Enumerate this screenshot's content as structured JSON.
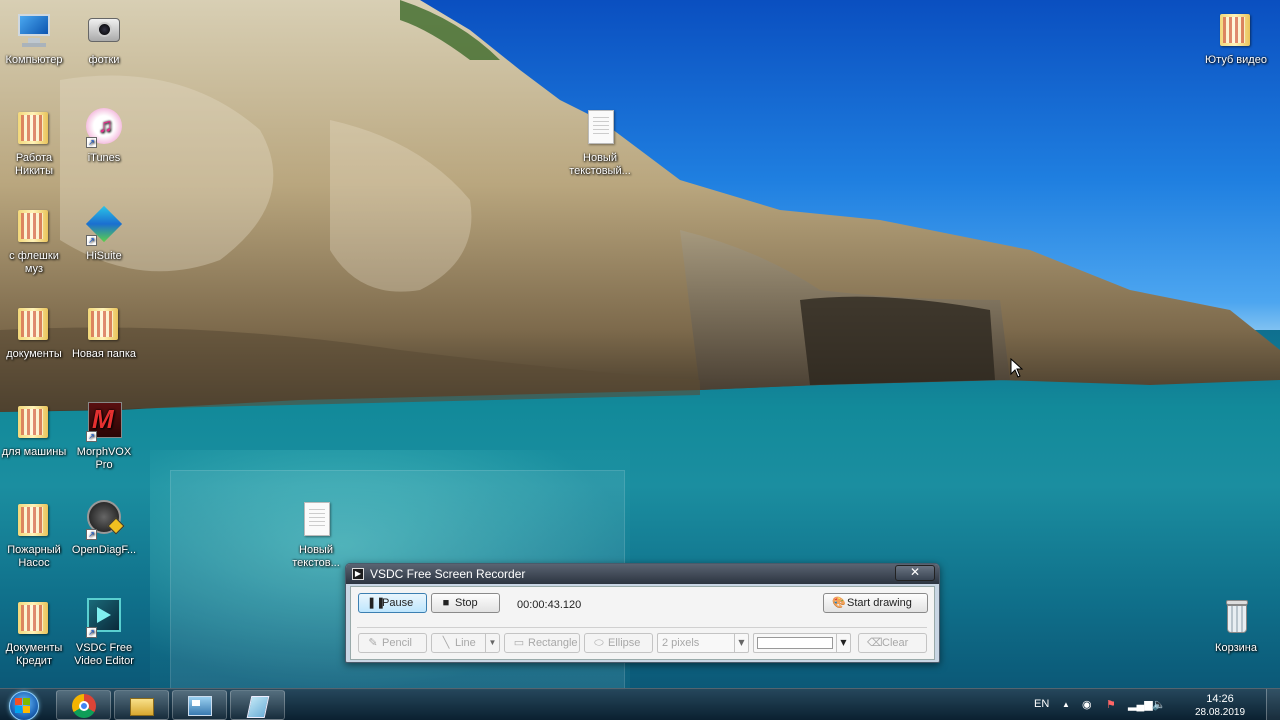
{
  "desktop": {
    "icons": [
      {
        "label": "Компьютер",
        "icon": "computer-icon"
      },
      {
        "label": "фотки",
        "icon": "camera-icon"
      },
      {
        "label": "Работа Никиты",
        "icon": "folder-icon"
      },
      {
        "label": "iTunes",
        "icon": "itunes-icon"
      },
      {
        "label": "с флешки муз",
        "icon": "folder-icon"
      },
      {
        "label": "HiSuite",
        "icon": "hisuite-icon"
      },
      {
        "label": "документы",
        "icon": "folder-icon"
      },
      {
        "label": "Новая папка",
        "icon": "folder-icon"
      },
      {
        "label": "для машины",
        "icon": "folder-icon"
      },
      {
        "label": "MorphVOX Pro",
        "icon": "morphvox-icon"
      },
      {
        "label": "Пожарный Насос",
        "icon": "folder-icon"
      },
      {
        "label": "OpenDiagF...",
        "icon": "opendiag-icon"
      },
      {
        "label": "Документы Кредит",
        "icon": "folder-icon"
      },
      {
        "label": "VSDC Free Video Editor",
        "icon": "vsdc-editor-icon"
      },
      {
        "label": "Новый текстовый...",
        "icon": "text-document-icon"
      },
      {
        "label": "Новый текстов...",
        "icon": "text-document-icon"
      },
      {
        "label": "Ютуб видео",
        "icon": "folder-icon"
      },
      {
        "label": "Корзина",
        "icon": "recycle-bin-icon"
      }
    ]
  },
  "recorder": {
    "title": "VSDC Free Screen Recorder",
    "close_glyph": "✕",
    "pause_label": "Pause",
    "stop_label": "Stop",
    "timer": "00:00:43.120",
    "start_drawing_label": "Start drawing",
    "pencil_label": "Pencil",
    "line_label": "Line",
    "rectangle_label": "Rectangle",
    "ellipse_label": "Ellipse",
    "thickness_value": "2 pixels",
    "clear_label": "Clear"
  },
  "taskbar": {
    "pinned": [
      {
        "icon": "chrome-icon"
      },
      {
        "icon": "explorer-icon"
      },
      {
        "icon": "vsdc-recorder-icon"
      },
      {
        "icon": "notepad-icon"
      }
    ],
    "language": "EN",
    "time": "14:26",
    "date": "28.08.2019"
  }
}
